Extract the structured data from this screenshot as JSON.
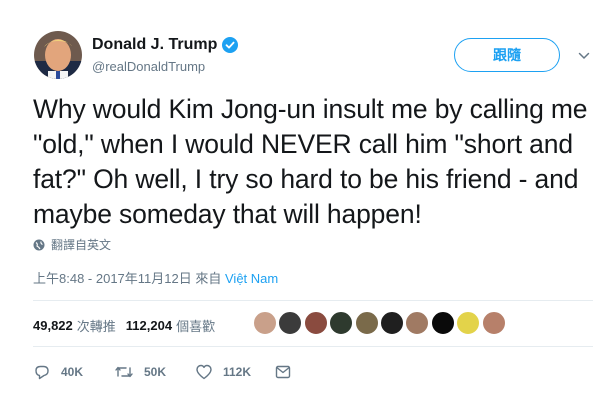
{
  "tweet": {
    "display_name": "Donald J. Trump",
    "handle": "@realDonaldTrump",
    "follow_label": "跟隨",
    "text": "Why would Kim Jong-un insult me by calling me \"old,\" when I would NEVER call him \"short and fat?\" Oh well, I try so hard to be his friend - and maybe someday that will happen!",
    "translate_label": "翻譯自英文",
    "timestamp": "上午8:48 - 2017年11月12日",
    "from_label": "來自",
    "location": "Việt Nam"
  },
  "stats": {
    "retweets_count": "49,822",
    "retweets_label": "次轉推",
    "likes_count": "112,204",
    "likes_label": "個喜歡"
  },
  "actions": {
    "reply_count": "40K",
    "retweet_count": "50K",
    "like_count": "112K"
  },
  "colors": {
    "accent": "#1da1f2",
    "muted": "#657786",
    "text": "#14171a",
    "divider": "#e6ecf0"
  },
  "icons": [
    "verified-badge-icon",
    "chevron-down-icon",
    "globe-icon",
    "reply-icon",
    "retweet-icon",
    "heart-icon",
    "message-icon"
  ],
  "likers": [
    "#c9a08a",
    "#3b3b3b",
    "#8a4b3f",
    "#2e3a2e",
    "#7a6a4a",
    "#1f1f1f",
    "#a07a63",
    "#0a0a0a",
    "#e3d34a",
    "#b7806a"
  ]
}
